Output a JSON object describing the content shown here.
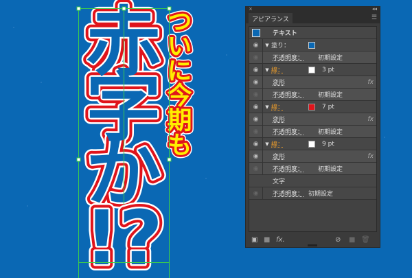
{
  "artwork": {
    "main_chars": [
      "赤",
      "字",
      "か",
      "!?"
    ],
    "sub_text": "ついに今期も"
  },
  "colors": {
    "canvas": "#0a68b4",
    "fill": "#0a68b4",
    "stroke_white": "#ffffff",
    "stroke_red": "#e0141b",
    "sub_fill": "#ffee00",
    "guide": "#3ccc4c"
  },
  "panel": {
    "close": "×",
    "collapse": "◂◂",
    "tab": "アピアランス",
    "menu_icon": "☰",
    "header": "テキスト",
    "fill_label": "塗り：",
    "opacity_label": "不透明度：",
    "opacity_value": "初期設定",
    "stroke_label": "線：",
    "effect_label": "変形",
    "fx": "fx",
    "strokes": [
      {
        "weight": "3 pt",
        "color": "#ffffff"
      },
      {
        "weight": "7 pt",
        "color": "#e0141b"
      },
      {
        "weight": "9 pt",
        "color": "#ffffff"
      }
    ],
    "char_label": "文字",
    "footer_fx": "fx."
  }
}
